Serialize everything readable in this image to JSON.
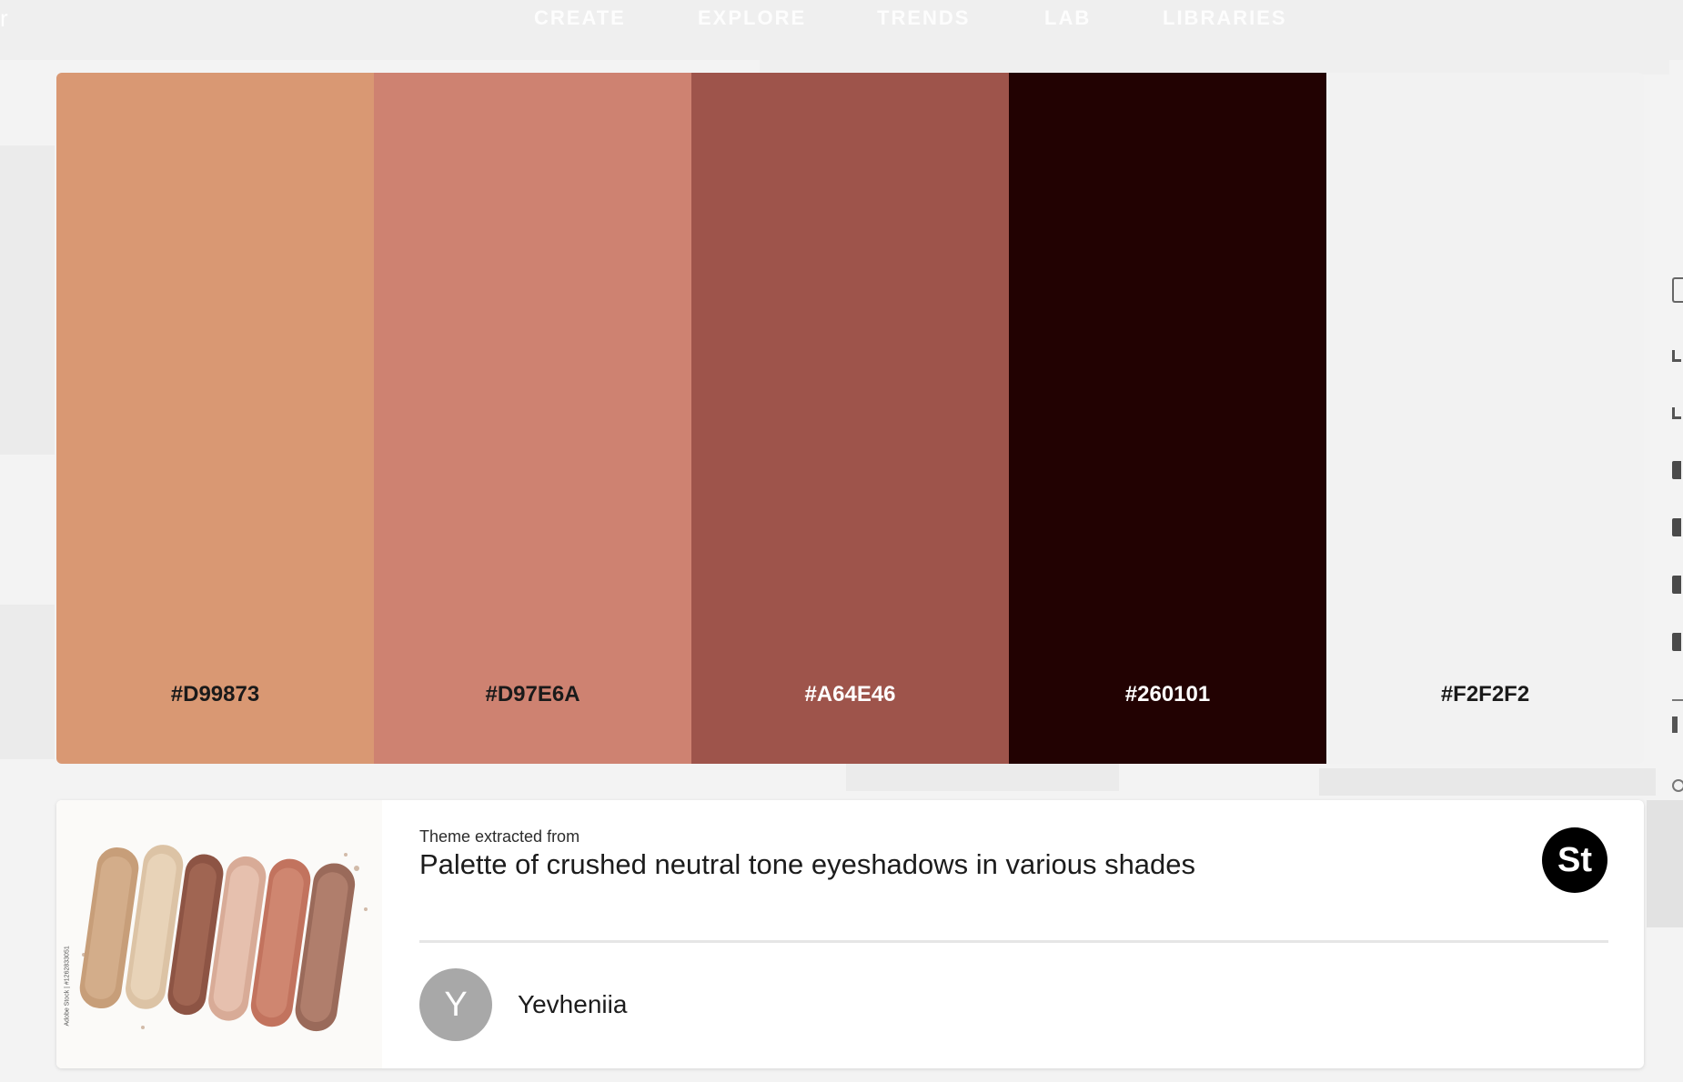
{
  "nav": {
    "items": [
      {
        "label": "CREATE"
      },
      {
        "label": "EXPLORE"
      },
      {
        "label": "TRENDS"
      },
      {
        "label": "LAB"
      },
      {
        "label": "LIBRARIES"
      }
    ]
  },
  "palette": {
    "swatches": [
      {
        "hex": "#D99873",
        "color": "#D99873",
        "text_color": "#1a1a1a"
      },
      {
        "hex": "#D97E6A",
        "color": "#CE8271",
        "text_color": "#1a1a1a"
      },
      {
        "hex": "#A64E46",
        "color": "#9E544B",
        "text_color": "#ffffff"
      },
      {
        "hex": "#260101",
        "color": "#220202",
        "text_color": "#ffffff"
      },
      {
        "hex": "#F2F2F2",
        "color": "#F2F2F2",
        "text_color": "#1a1a1a"
      }
    ]
  },
  "source": {
    "caption": "Theme extracted from",
    "title": "Palette of crushed neutral tone eyeshadows in various shades",
    "badge": "St",
    "credit": "Adobe Stock | #1262833051",
    "author": {
      "initial": "Y",
      "name": "Yevheniia"
    }
  }
}
